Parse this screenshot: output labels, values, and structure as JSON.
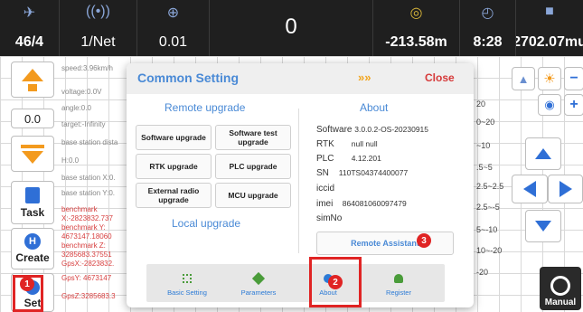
{
  "topbar": {
    "satellites": "46/4",
    "network": "1/Net",
    "precision": "0.01",
    "center_value": "0",
    "elevation": "-213.58m",
    "time": "8:28",
    "distance": "2702.07mu"
  },
  "left": {
    "step_value": "0.0",
    "task_label": "Task",
    "create_label": "Create",
    "set_label": "Set",
    "info": [
      "speed:3.96km/h",
      "voltage:0.0V",
      "angle:0.0",
      "target:-Infinity",
      "base station dista",
      "H:0.0",
      "base station X:0.",
      "base station Y:0.",
      "benchmark",
      "X:-2823832.737",
      "benchmark Y:",
      "4673147.18060",
      "benchmark Z:",
      "3285683.37551",
      "GpsX:-2823832.",
      "GpsY: 4673147",
      "GpsZ:3285683.3"
    ]
  },
  "right_values": [
    "20",
    "0~20",
    "~10",
    ".5~5",
    "2.5~2.5",
    "2.5~-5",
    "5~-10",
    "10~-20",
    "-20"
  ],
  "manual_label": "Manual",
  "dialog": {
    "title": "Common Setting",
    "chevrons": "»»",
    "close_label": "Close",
    "remote_upgrade_title": "Remote upgrade",
    "about_title": "About",
    "local_upgrade_title": "Local upgrade",
    "buttons": {
      "software_upgrade": "Software upgrade",
      "software_test_upgrade": "Software test upgrade",
      "rtk_upgrade": "RTK upgrade",
      "plc_upgrade": "PLC upgrade",
      "external_radio_upgrade": "External radio upgrade",
      "mcu_upgrade": "MCU upgrade"
    },
    "about": {
      "software_key": "Software",
      "software_val": "3.0.0.2-OS-20230915",
      "rtk_key": "RTK",
      "rtk_val": "null null",
      "plc_key": "PLC",
      "plc_val": "4.12.201",
      "sn_key": "SN",
      "sn_val": "110TS04374400077",
      "iccid_key": "iccid",
      "imei_key": "imei",
      "imei_val": "864081060097479",
      "simno_key": "simNo"
    },
    "remote_assistant_label": "Remote Assistant",
    "tabs": {
      "basic_setting": "Basic Setting",
      "parameters": "Parameters",
      "about": "About",
      "register": "Register"
    }
  },
  "badges": [
    "1",
    "2",
    "3"
  ],
  "colors": {
    "accent_blue": "#4a8ad6",
    "highlight_red": "#e02424",
    "orange": "#f39a1e",
    "topbar_bg": "#1f1f1f"
  }
}
